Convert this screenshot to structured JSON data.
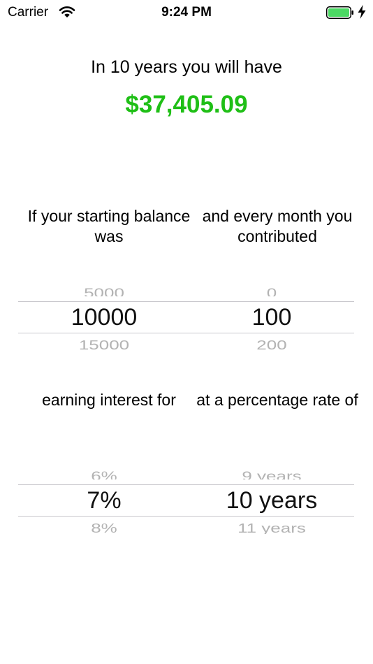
{
  "status_bar": {
    "carrier": "Carrier",
    "time": "9:24 PM",
    "battery_level": 1.0,
    "battery_color": "#4cd964"
  },
  "summary": {
    "headline": "In 10 years you will have",
    "amount": "$37,405.09",
    "amount_color": "#1fbf16"
  },
  "labels": {
    "starting_balance": "If your starting balance was",
    "monthly_contribution": "and every month you contributed",
    "earning_interest": "earning interest for",
    "percentage_rate": "at a percentage rate of"
  },
  "pickers": {
    "balance": {
      "prev": "5000",
      "selected": "10000",
      "next": "15000"
    },
    "contribution": {
      "prev": "0",
      "selected": "100",
      "next": "200"
    },
    "rate": {
      "prev": "6%",
      "selected": "7%",
      "next": "8%"
    },
    "years": {
      "prev": "9 years",
      "selected": "10 years",
      "next": "11 years"
    }
  }
}
